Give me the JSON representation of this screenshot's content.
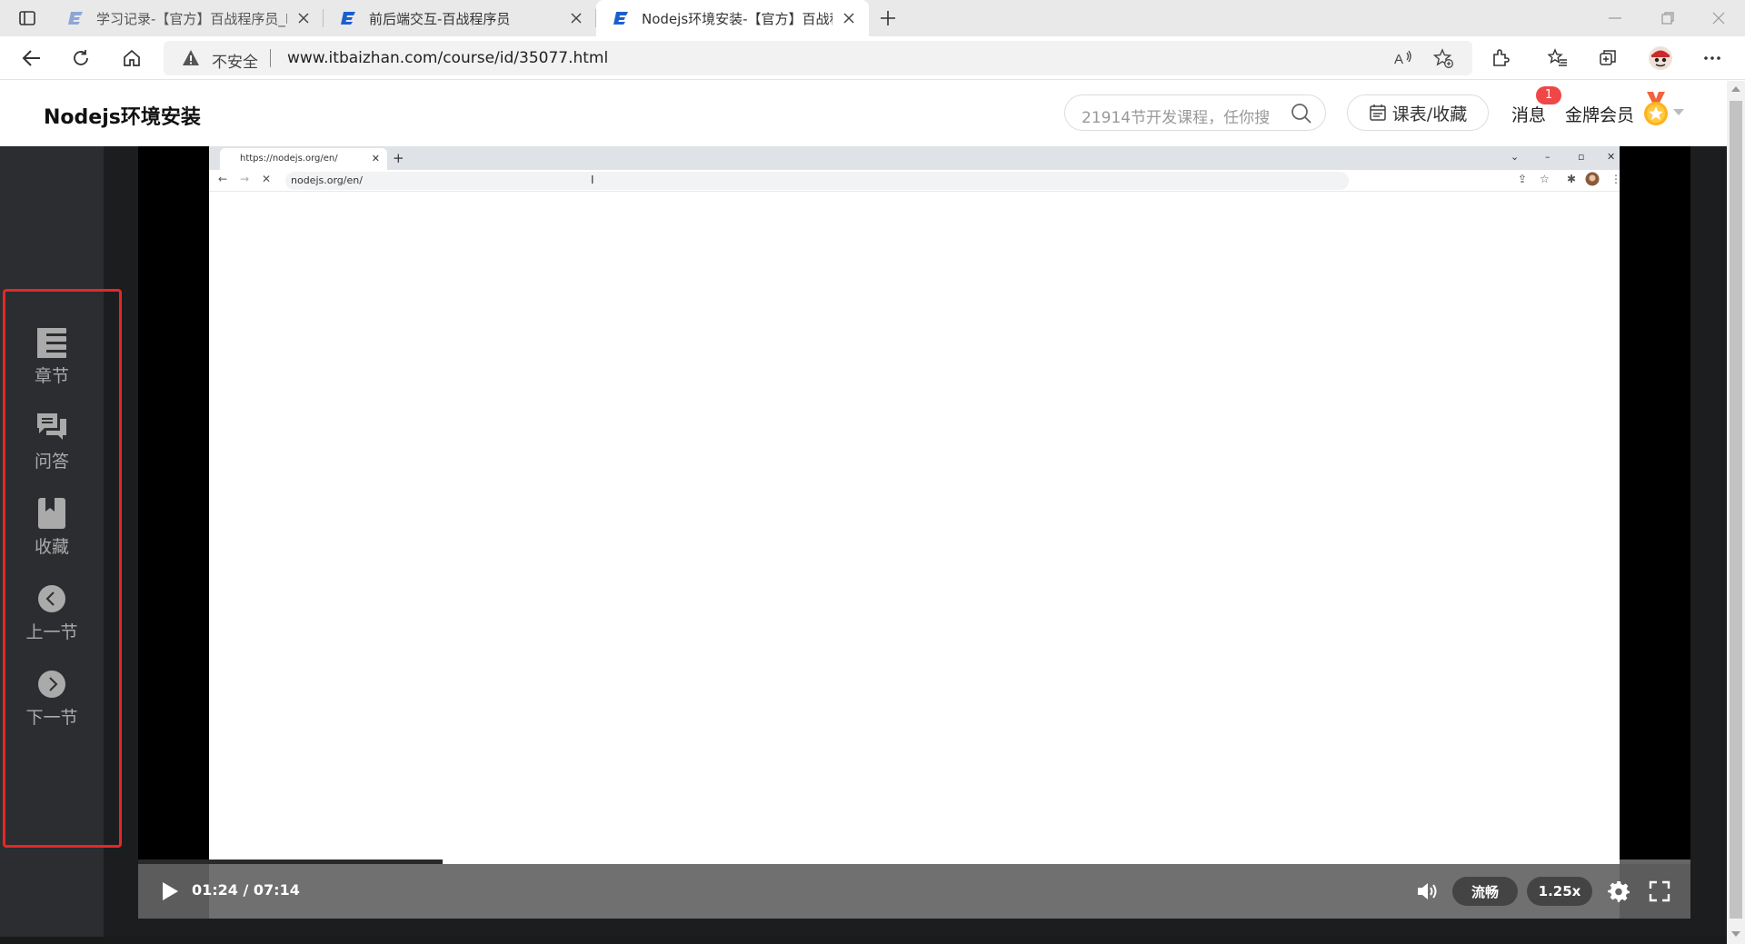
{
  "browser": {
    "tabs": [
      {
        "title": "学习记录-【官方】百战程序员_IT",
        "active": false
      },
      {
        "title": "前后端交互-百战程序员",
        "active": false
      },
      {
        "title": "Nodejs环境安装-【官方】百战程",
        "active": true
      }
    ],
    "address": {
      "security_label": "不安全",
      "url": "www.itbaizhan.com/course/id/35077.html"
    }
  },
  "site": {
    "page_title": "Nodejs环境安装",
    "search_placeholder": "21914节开发课程，任你搜",
    "course_button": "课表/收藏",
    "messages_label": "消息",
    "messages_badge": "1",
    "member_label": "金牌会员"
  },
  "sidebar": {
    "items": [
      {
        "label": "章节",
        "icon": "chapter-icon"
      },
      {
        "label": "问答",
        "icon": "qa-icon"
      },
      {
        "label": "收藏",
        "icon": "bookmark-icon"
      },
      {
        "label": "上一节",
        "icon": "prev-icon"
      },
      {
        "label": "下一节",
        "icon": "next-icon"
      }
    ]
  },
  "video_content": {
    "tab_title": "https://nodejs.org/en/",
    "url": "nodejs.org/en/"
  },
  "player": {
    "current_time": "01:24",
    "duration": "07:14",
    "time_display": "01:24 / 07:14",
    "progress_fraction": 0.196,
    "quality_label": "流畅",
    "speed_label": "1.25x"
  },
  "colors": {
    "highlight_outline": "#e52727",
    "badge": "#f04646",
    "brand_blue": "#1a5fd0"
  }
}
